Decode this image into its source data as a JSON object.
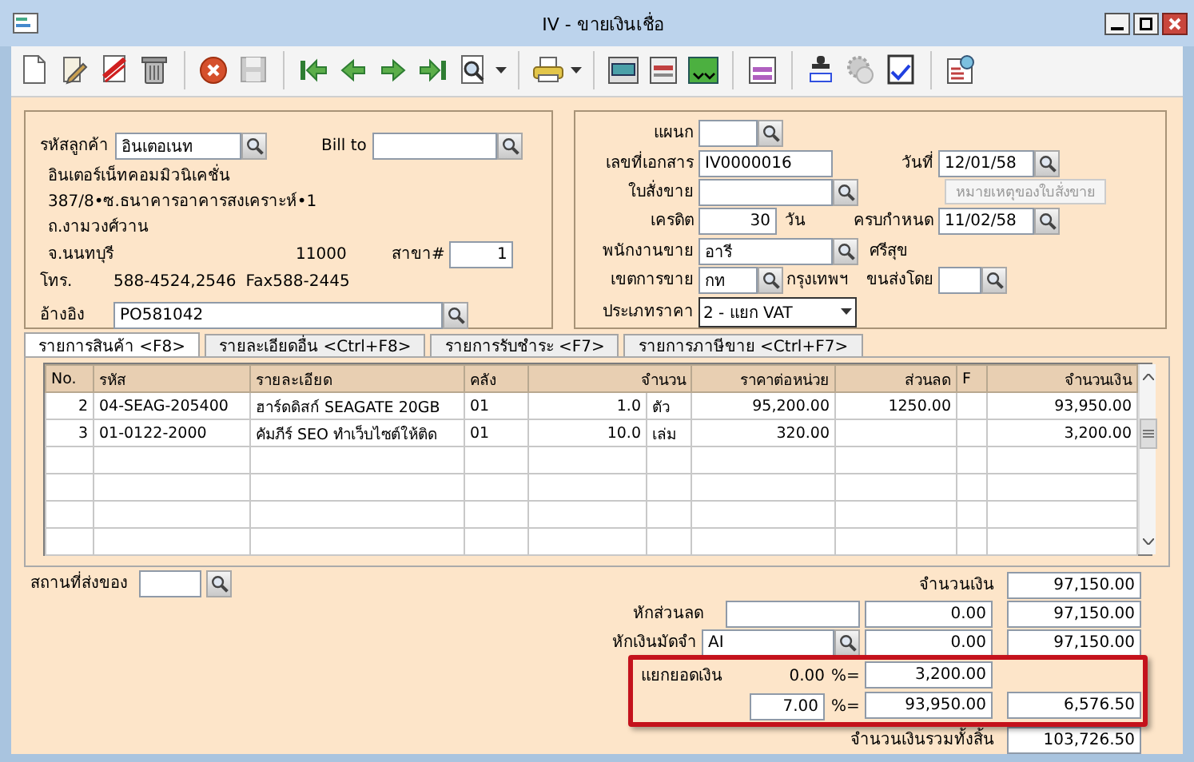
{
  "window": {
    "title": "IV - ขายเงินเชื่อ"
  },
  "toolbar": [
    {
      "disabled": false
    },
    {
      "disabled": false
    },
    {
      "disabled": false
    },
    {
      "disabled": false
    },
    {
      "disabled": false
    },
    {
      "disabled": true
    },
    {
      "disabled": false
    },
    {
      "disabled": false
    },
    {
      "disabled": false
    },
    {
      "disabled": false
    },
    {
      "disabled": false
    },
    {
      "disabled": false
    },
    {
      "disabled": false
    },
    {
      "disabled": false
    },
    {
      "disabled": false
    },
    {
      "disabled": false
    },
    {
      "disabled": false
    },
    {
      "disabled": true
    },
    {
      "disabled": false
    },
    {
      "disabled": false
    }
  ],
  "customer": {
    "code_label": "รหัสลูกค้า",
    "code": "อินเตอเนท",
    "bill_to_label": "Bill to",
    "name": "อินเตอร์เน็ทคอมมิวนิเคชั่น",
    "address": [
      "387/8•ซ.ธนาคารอาคารสงเคราะห์•1",
      "ถ.งามวงศ์วาน"
    ],
    "province": "จ.นนทบุรี",
    "postcode": "11000",
    "branch_label": "สาขา#",
    "branch": "1",
    "phone_label": "โทร.",
    "phone": "588-4524,2546",
    "fax": "Fax588-2445",
    "ref_label": "อ้างอิง",
    "ref": "PO581042"
  },
  "document": {
    "department_label": "แผนก",
    "doc_no_label": "เลขที่เอกสาร",
    "doc_no": "IV0000016",
    "date_label": "วันที่",
    "date": "12/01/58",
    "order_label": "ใบสั่งขาย",
    "order_note_button": {
      "label": "หมายเหตุของใบสั่งขาย",
      "disabled": true
    },
    "credit_label": "เครดิต",
    "credit": "30",
    "credit_unit": "วัน",
    "due_label": "ครบกำหนด",
    "due": "11/02/58",
    "salesman_label": "พนักงานขาย",
    "salesman": "อารี",
    "salesman_name": "ศรีสุข",
    "area_label": "เขตการขาย",
    "area": "กท",
    "area_name": "กรุงเทพฯ",
    "shipper_label": "ขนส่งโดย",
    "price_type_label": "ประเภทราคา",
    "price_type": "2 - แยก VAT"
  },
  "tabs": [
    {
      "label": "รายการสินค้า <F8>",
      "selected": true
    },
    {
      "label": "รายละเอียดอื่น  <Ctrl+F8>",
      "selected": false
    },
    {
      "label": "รายการรับชำระ <F7>",
      "selected": false
    },
    {
      "label": "รายการภาษีขาย <Ctrl+F7>",
      "selected": false
    }
  ],
  "table": {
    "columns": [
      "No.",
      "รหัส",
      "รายละเอียด",
      "คลัง",
      "จำนวน",
      "ราคาต่อหน่วย",
      "ส่วนลด",
      "F",
      "จำนวนเงิน"
    ],
    "rows": [
      {
        "no": "2",
        "code": "04-SEAG-205400",
        "description": "ฮาร์ดดิสก์ SEAGATE 20GB",
        "warehouse": "01",
        "quantity": "1.0",
        "unit": "ตัว",
        "unit_price": "95,200.00",
        "discount": "1250.00",
        "amount": "93,950.00"
      },
      {
        "no": "3",
        "code": "01-0122-2000",
        "description": "คัมภีร์ SEO ทำเว็บไซต์ให้ติด",
        "warehouse": "01",
        "quantity": "10.0",
        "unit": "เล่ม",
        "unit_price": "320.00",
        "amount": "3,200.00"
      }
    ]
  },
  "footer": {
    "delivery_label": "สถานที่ส่งของ",
    "subtotal_label": "จำนวนเงิน",
    "subtotal": "97,150.00",
    "discount_label": "หักส่วนลด",
    "discount": "0.00",
    "after_discount": "97,150.00",
    "deposit_label": "หักเงินมัดจำ",
    "deposit_code": "AI",
    "deposit": "0.00",
    "after_deposit": "97,150.00",
    "split": {
      "highlighted": true,
      "label": "แยกยอดเงิน",
      "exempt_rate": "0.00",
      "exempt_sign": "%=",
      "exempt_amount": "3,200.00",
      "vat_rate": "7.00",
      "vat_sign": "%=",
      "vat_base": "93,950.00",
      "vat_amount": "6,576.50"
    },
    "grand_total_label": "จำนวนเงินรวมทั้งสิ้น",
    "grand_total": "103,726.50"
  }
}
